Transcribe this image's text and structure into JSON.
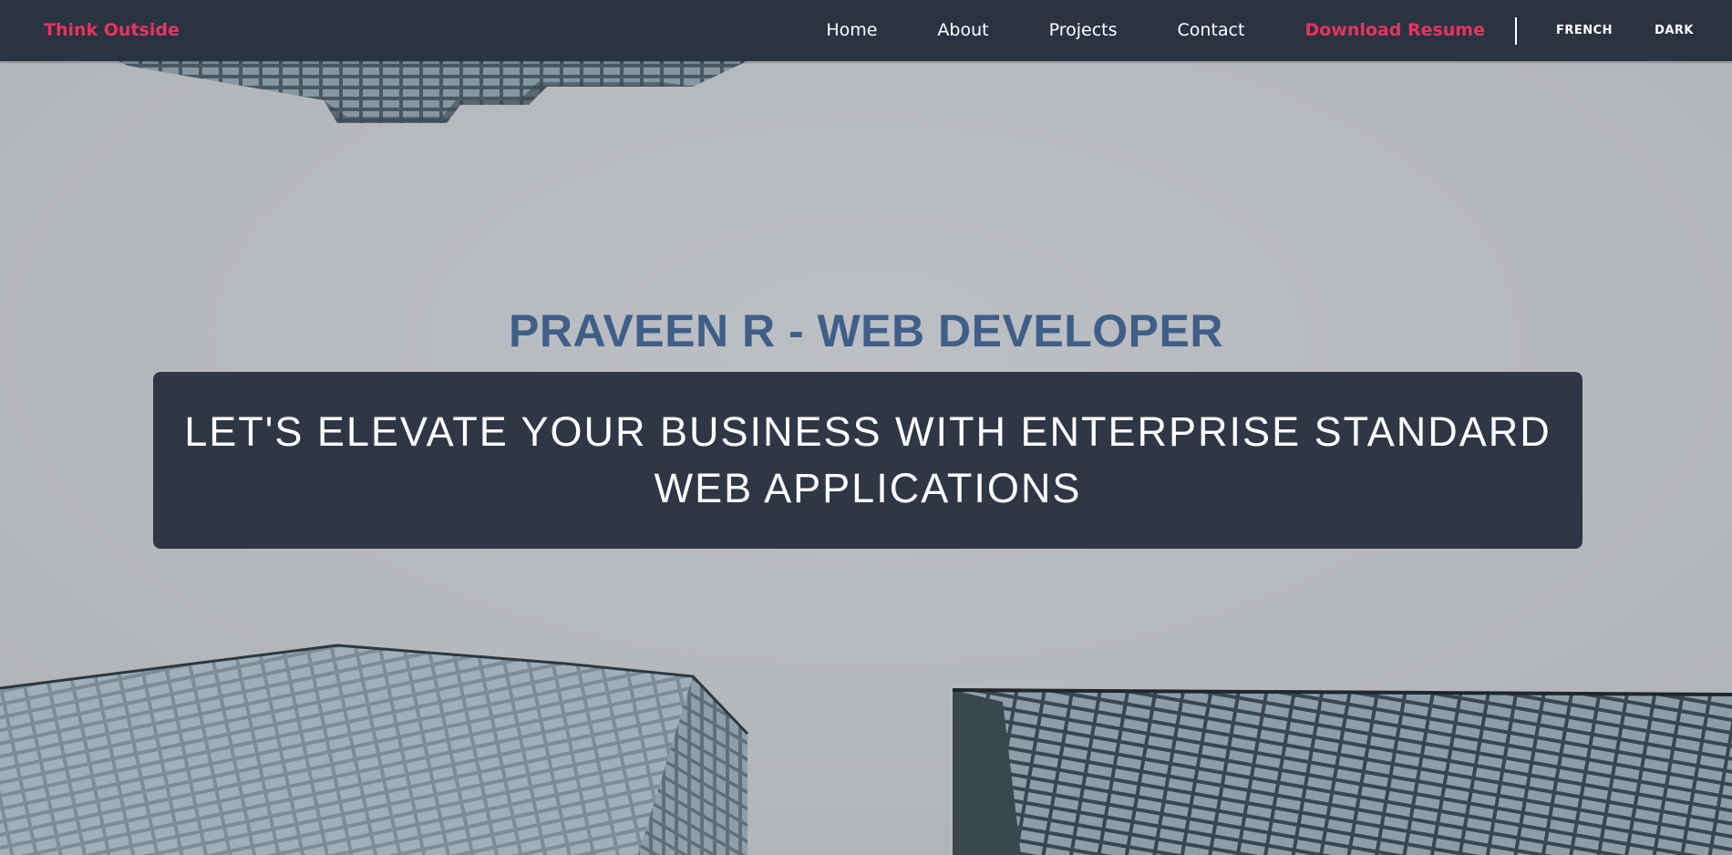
{
  "brand": {
    "name": "Think Outside",
    "color": "#e8345f"
  },
  "nav": {
    "items": [
      {
        "label": "Home"
      },
      {
        "label": "About"
      },
      {
        "label": "Projects"
      },
      {
        "label": "Contact"
      }
    ],
    "download_label": "Download Resume",
    "language_label": "FRENCH",
    "theme_label": "DARK",
    "background": "#2a3342"
  },
  "hero": {
    "title": "PRAVEEN R - WEB DEVELOPER",
    "tagline": "LET'S ELEVATE YOUR BUSINESS WITH ENTERPRISE STANDARD WEB APPLICATIONS",
    "title_color": "#3f5f89",
    "box_color": "#2f3747"
  }
}
